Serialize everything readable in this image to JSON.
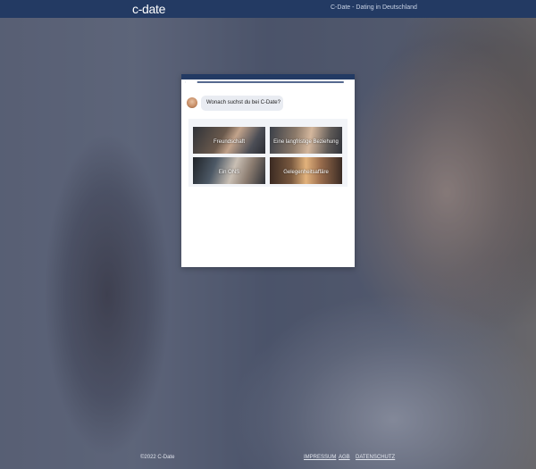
{
  "header": {
    "logo": "c-date",
    "tagline": "C-Date - Dating in Deutschland"
  },
  "quiz": {
    "progress_fraction": 0.08,
    "question": "Wonach suchst du bei C-Date?",
    "options": [
      {
        "label": "Freundschaft"
      },
      {
        "label": "Eine langfristige Beziehung"
      },
      {
        "label": "Ein ONS"
      },
      {
        "label": "Gelegenheitsaffäre"
      }
    ]
  },
  "footer": {
    "copyright": "©2022 C-Date",
    "links": [
      "IMPRESSUM",
      "AGB",
      "DATENSCHUTZ"
    ]
  }
}
